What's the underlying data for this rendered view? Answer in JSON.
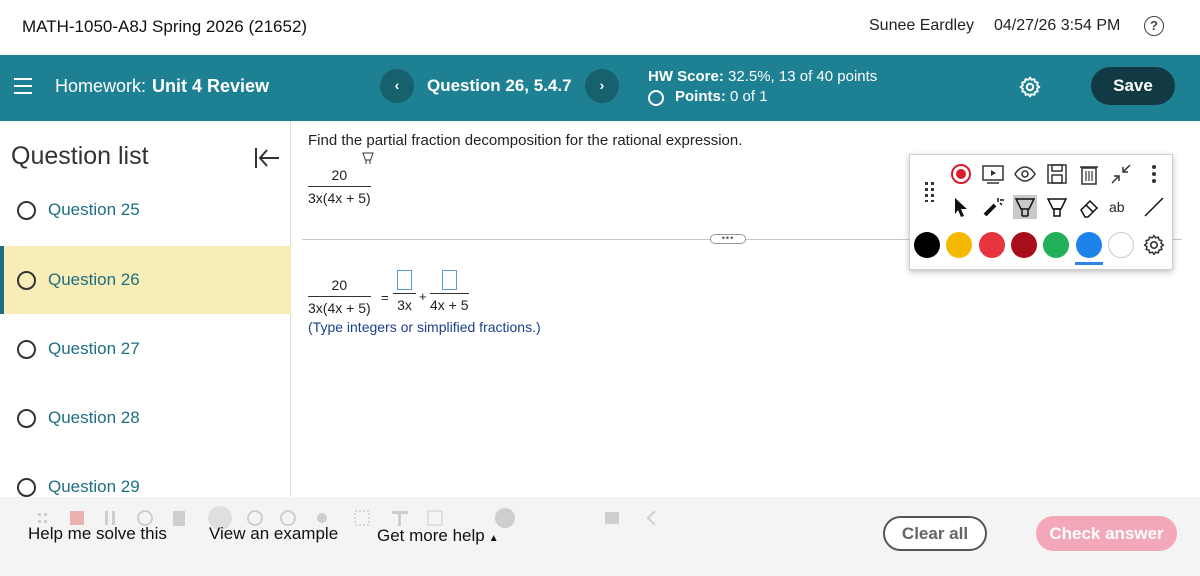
{
  "header": {
    "course": "MATH-1050-A8J Spring 2026 (21652)",
    "user": "Sunee Eardley",
    "datetime": "04/27/26 3:54 PM",
    "help_glyph": "?"
  },
  "hwbar": {
    "homework_label": "Homework:",
    "homework_name": "Unit 4 Review",
    "question_title": "Question 26, 5.4.7",
    "prev_glyph": "‹",
    "next_glyph": "›",
    "score_label": "HW Score:",
    "score_value": "32.5%, 13 of 40 points",
    "points_label": "Points:",
    "points_value": "0 of 1",
    "save_label": "Save"
  },
  "sidebar": {
    "title": "Question list",
    "items": [
      {
        "label": "Question 25"
      },
      {
        "label": "Question 26"
      },
      {
        "label": "Question 27"
      },
      {
        "label": "Question 28"
      },
      {
        "label": "Question 29"
      }
    ]
  },
  "question": {
    "prompt": "Find the partial fraction decomposition for the rational expression.",
    "expr_numerator": "20",
    "expr_denominator": "3x(4x + 5)",
    "eq_numerator": "20",
    "eq_denominator": "3x(4x + 5)",
    "equals": "=",
    "plus": "+",
    "term1_denominator": "3x",
    "term2_denominator": "4x + 5",
    "hint": "(Type integers or simplified fractions.)",
    "divider_handle": "•••"
  },
  "drawing_toolbar": {
    "colors": [
      "#000000",
      "#f5b800",
      "#e8343f",
      "#a80f1c",
      "#22b15a",
      "#1d83ea",
      "#ffffff"
    ],
    "selected_color": "#1d83ea",
    "text_tool_label": "ab"
  },
  "bottom": {
    "help_solve": "Help me solve this",
    "view_example": "View an example",
    "more_help": "Get more help",
    "more_help_caret": "▲",
    "clear_all": "Clear all",
    "check_answer": "Check answer"
  }
}
